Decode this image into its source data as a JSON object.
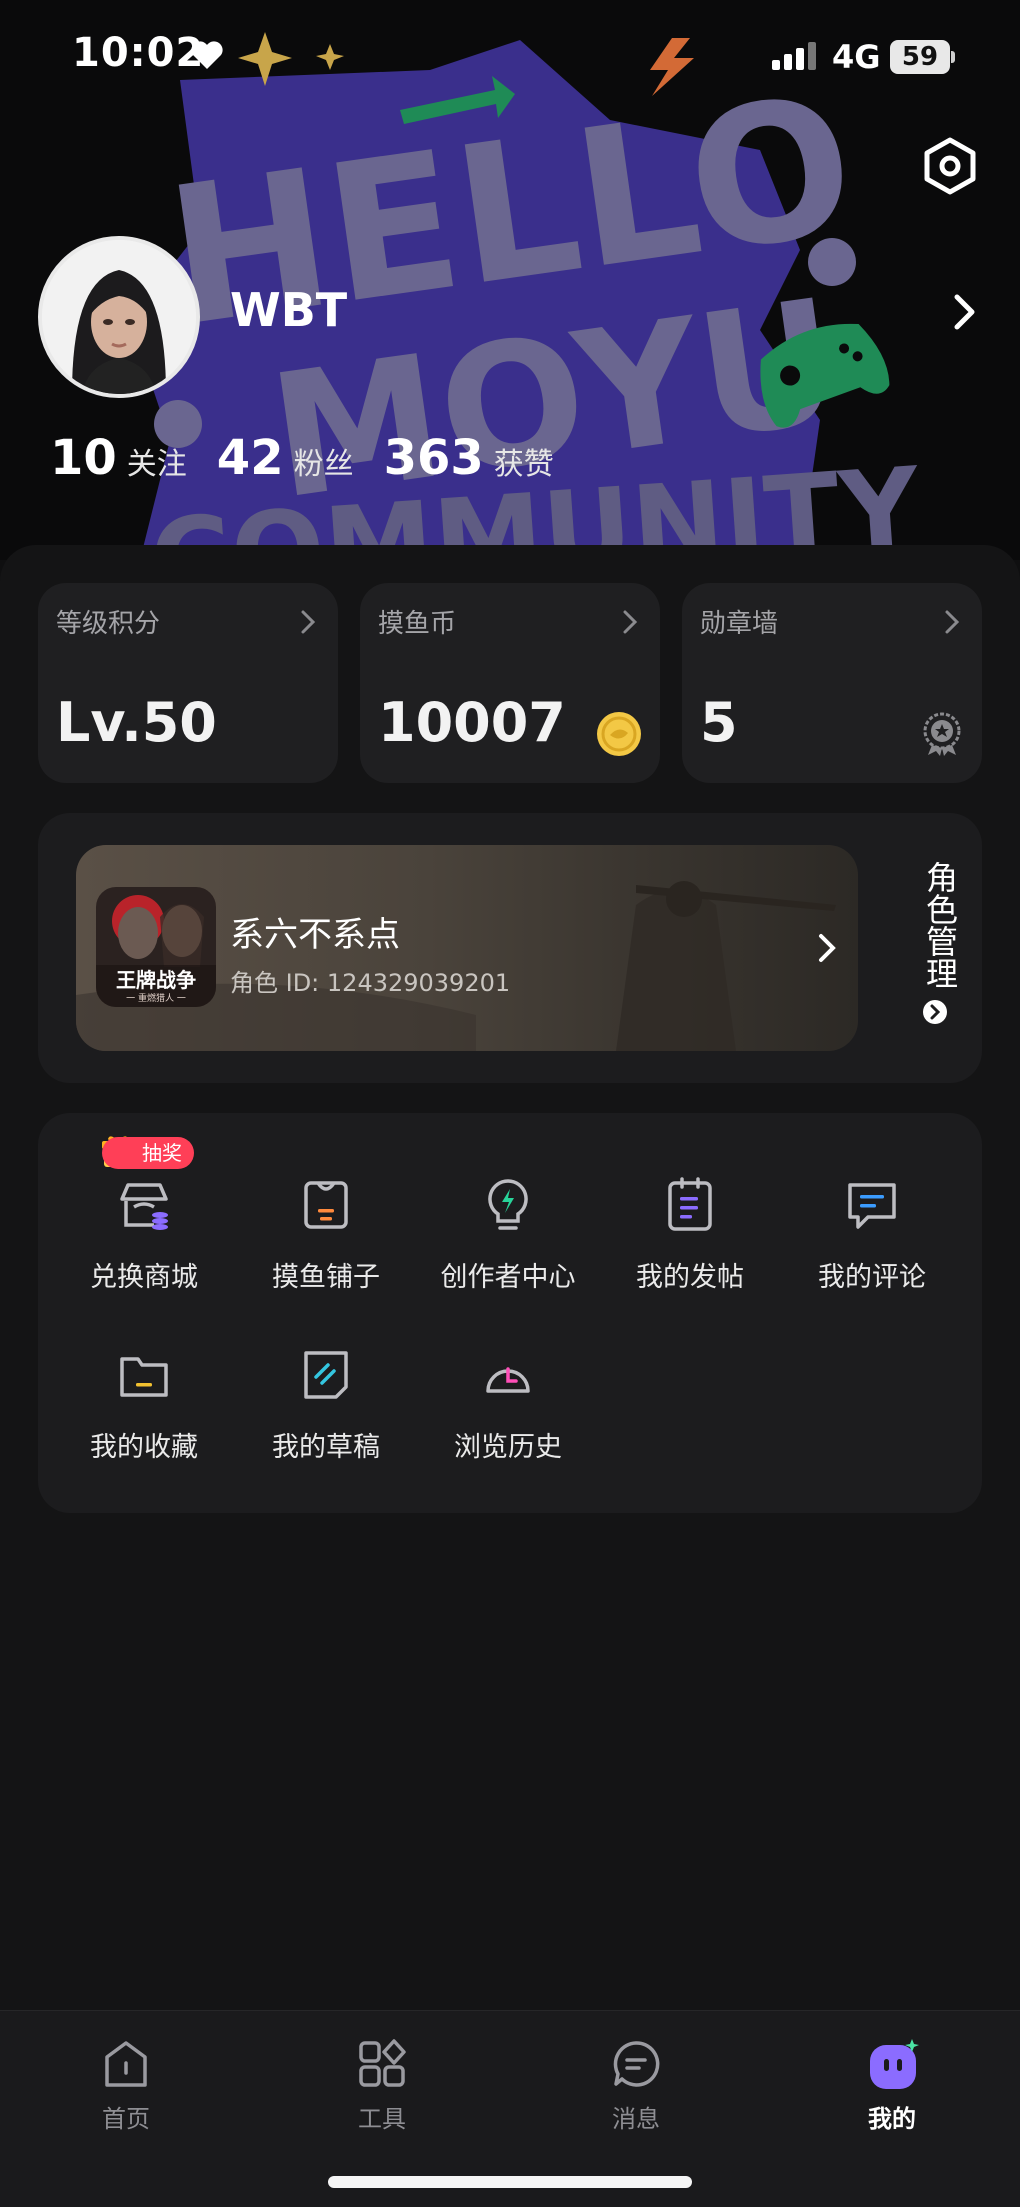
{
  "status_bar": {
    "time": "10:02",
    "network": "4G",
    "battery": "59"
  },
  "header": {
    "banner_text": [
      "HELLO",
      "MOYU",
      "COMMUNITY"
    ],
    "username": "WBT",
    "stats": [
      {
        "value": "10",
        "label": "关注"
      },
      {
        "value": "42",
        "label": "粉丝"
      },
      {
        "value": "363",
        "label": "获赞"
      }
    ]
  },
  "cards": [
    {
      "title": "等级积分",
      "value": "Lv.50"
    },
    {
      "title": "摸鱼币",
      "value": "10007"
    },
    {
      "title": "勋章墙",
      "value": "5"
    }
  ],
  "role": {
    "game_name": "王牌战争",
    "game_subtitle": "一 重燃猎人 一",
    "name": "系六不系点",
    "id_label": "角色 ID: 124329039201",
    "manage_label": "角色管理"
  },
  "tools": {
    "badge": "抽奖",
    "items": [
      {
        "label": "兑换商城",
        "icon": "store-icon"
      },
      {
        "label": "摸鱼铺子",
        "icon": "shop-bag-icon"
      },
      {
        "label": "创作者中心",
        "icon": "lightbulb-icon"
      },
      {
        "label": "我的发帖",
        "icon": "post-icon"
      },
      {
        "label": "我的评论",
        "icon": "comment-icon"
      },
      {
        "label": "我的收藏",
        "icon": "folder-icon"
      },
      {
        "label": "我的草稿",
        "icon": "draft-icon"
      },
      {
        "label": "浏览历史",
        "icon": "history-icon"
      }
    ]
  },
  "tabbar": [
    {
      "label": "首页",
      "icon": "home-icon"
    },
    {
      "label": "工具",
      "icon": "tools-icon"
    },
    {
      "label": "消息",
      "icon": "message-icon"
    },
    {
      "label": "我的",
      "icon": "profile-icon",
      "active": true
    }
  ],
  "colors": {
    "background": "#0f0f10",
    "card": "#1f1f21",
    "accent_purple": "#8b6cff",
    "badge_red": "#ff3f57"
  }
}
